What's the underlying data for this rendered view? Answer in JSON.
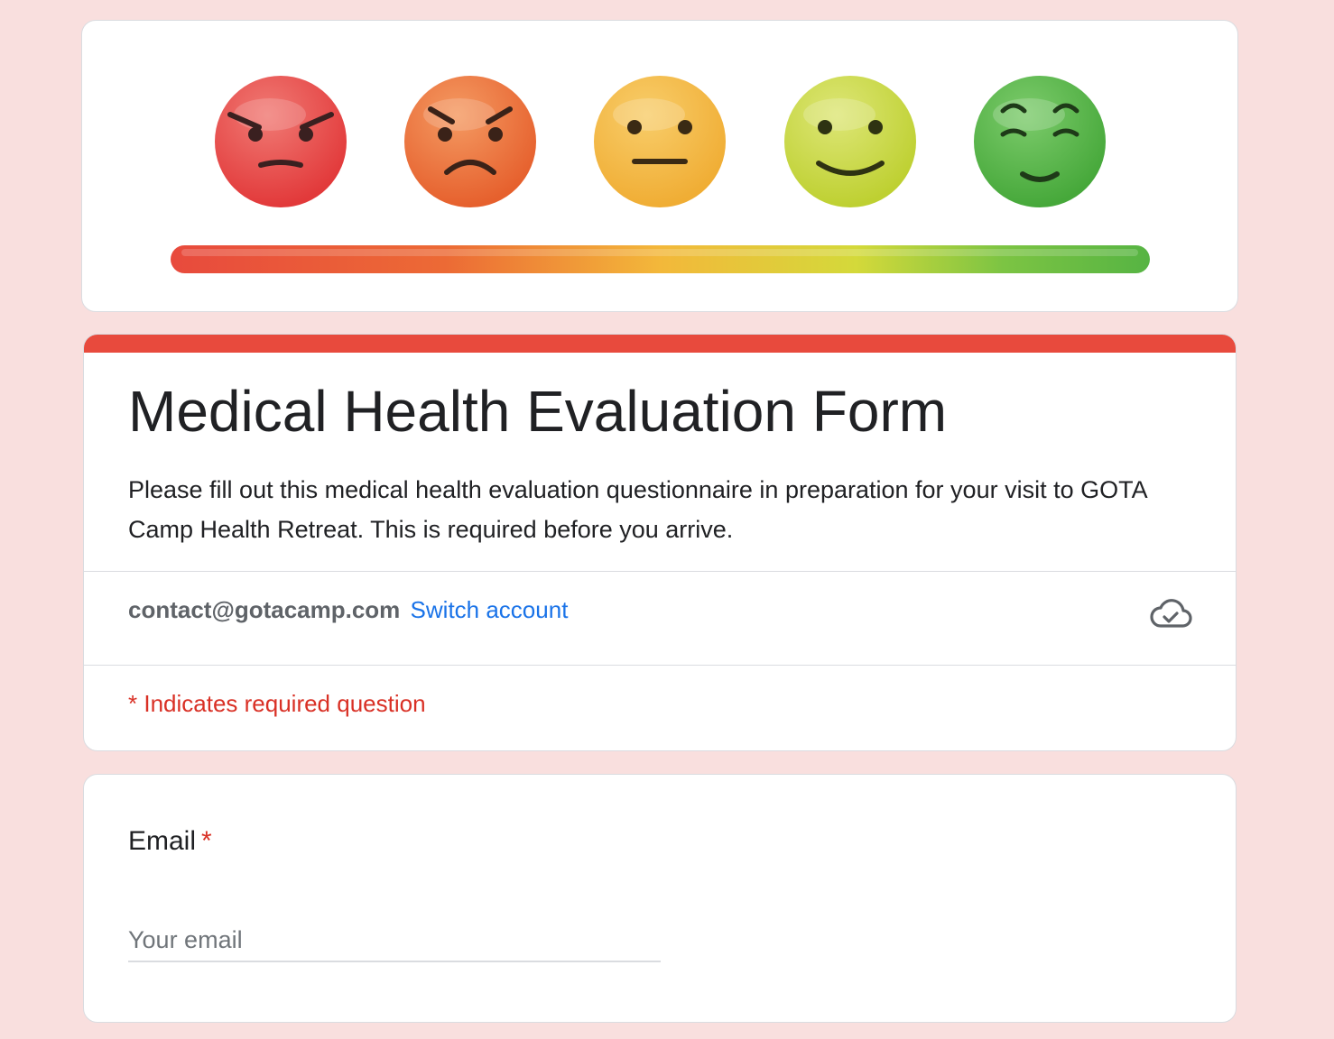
{
  "header": {
    "rating_faces": [
      "angry-face-icon",
      "frowning-face-icon",
      "neutral-face-icon",
      "smiling-face-icon",
      "content-face-icon"
    ],
    "face_colors": [
      "#e8443f",
      "#ec6a35",
      "#f3b83a",
      "#c9d840",
      "#56b443"
    ],
    "scale_colors": [
      "#e84a3d",
      "#f3b83a",
      "#56b443"
    ]
  },
  "form": {
    "title": "Medical Health Evaluation Form",
    "description": "Please fill out this medical health evaluation questionnaire in preparation for your visit to GOTA Camp Health Retreat. This is required before you arrive.",
    "accent_color": "#e84a3d"
  },
  "account": {
    "email": "contact@gotacamp.com",
    "switch_label": "Switch account",
    "status_icon": "cloud-check-icon"
  },
  "required_note": "* Indicates required question",
  "questions": [
    {
      "label": "Email",
      "required_marker": "*",
      "placeholder": "Your email",
      "value": ""
    }
  ]
}
